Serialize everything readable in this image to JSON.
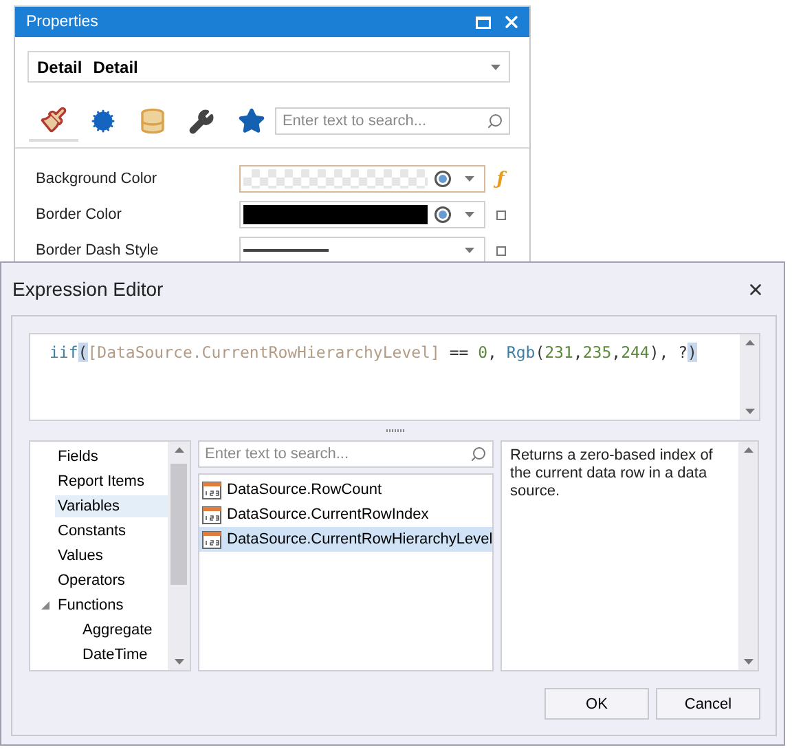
{
  "properties_window": {
    "title": "Properties",
    "object_selector": {
      "name": "Detail",
      "type": "Detail"
    },
    "tabs": [
      {
        "kind": "brush",
        "selected": true
      },
      {
        "kind": "gears",
        "selected": false
      },
      {
        "kind": "database",
        "selected": false
      },
      {
        "kind": "wrench",
        "selected": false
      },
      {
        "kind": "star",
        "selected": false
      }
    ],
    "search": {
      "placeholder": "Enter text to search..."
    },
    "rows": [
      {
        "label": "Background Color",
        "kind": "transparent",
        "expression_icon": "ƒ",
        "focused": true
      },
      {
        "label": "Border Color",
        "kind": "color",
        "color": "#000000",
        "focused": false
      },
      {
        "label": "Border Dash Style",
        "kind": "line",
        "focused": false
      }
    ]
  },
  "expression_editor": {
    "title": "Expression Editor",
    "tokens": [
      {
        "text": "iif",
        "kind": "function",
        "highlighted": false
      },
      {
        "text": "(",
        "kind": "punct",
        "highlighted": true
      },
      {
        "text": "[DataSource.CurrentRowHierarchyLevel]",
        "kind": "field",
        "highlighted": false
      },
      {
        "text": " == ",
        "kind": "punct",
        "highlighted": false
      },
      {
        "text": "0",
        "kind": "number",
        "highlighted": false
      },
      {
        "text": ", ",
        "kind": "punct",
        "highlighted": false
      },
      {
        "text": "Rgb",
        "kind": "function",
        "highlighted": false
      },
      {
        "text": "(",
        "kind": "punct",
        "highlighted": false
      },
      {
        "text": "231",
        "kind": "number",
        "highlighted": false
      },
      {
        "text": ",",
        "kind": "punct",
        "highlighted": false
      },
      {
        "text": "235",
        "kind": "number",
        "highlighted": false
      },
      {
        "text": ",",
        "kind": "punct",
        "highlighted": false
      },
      {
        "text": "244",
        "kind": "number",
        "highlighted": false
      },
      {
        "text": "), ?",
        "kind": "punct",
        "highlighted": false
      },
      {
        "text": ")",
        "kind": "punct",
        "highlighted": true
      }
    ],
    "categories": [
      {
        "label": "Fields",
        "selected": false
      },
      {
        "label": "Report Items",
        "selected": false
      },
      {
        "label": "Variables",
        "selected": true
      },
      {
        "label": "Constants",
        "selected": false
      },
      {
        "label": "Values",
        "selected": false
      },
      {
        "label": "Operators",
        "selected": false
      },
      {
        "label": "Functions",
        "selected": false,
        "expanded": true,
        "children": [
          {
            "label": "Aggregate",
            "selected": false
          },
          {
            "label": "DateTime",
            "selected": false
          }
        ]
      }
    ],
    "search": {
      "placeholder": "Enter text to search..."
    },
    "items": [
      {
        "label": "DataSource.RowCount",
        "selected": false
      },
      {
        "label": "DataSource.CurrentRowIndex",
        "selected": false
      },
      {
        "label": "DataSource.CurrentRowHierarchyLevel",
        "selected": true
      }
    ],
    "description": "Returns a zero-based index of the current data row in a data source.",
    "buttons": [
      "OK",
      "Cancel"
    ]
  }
}
